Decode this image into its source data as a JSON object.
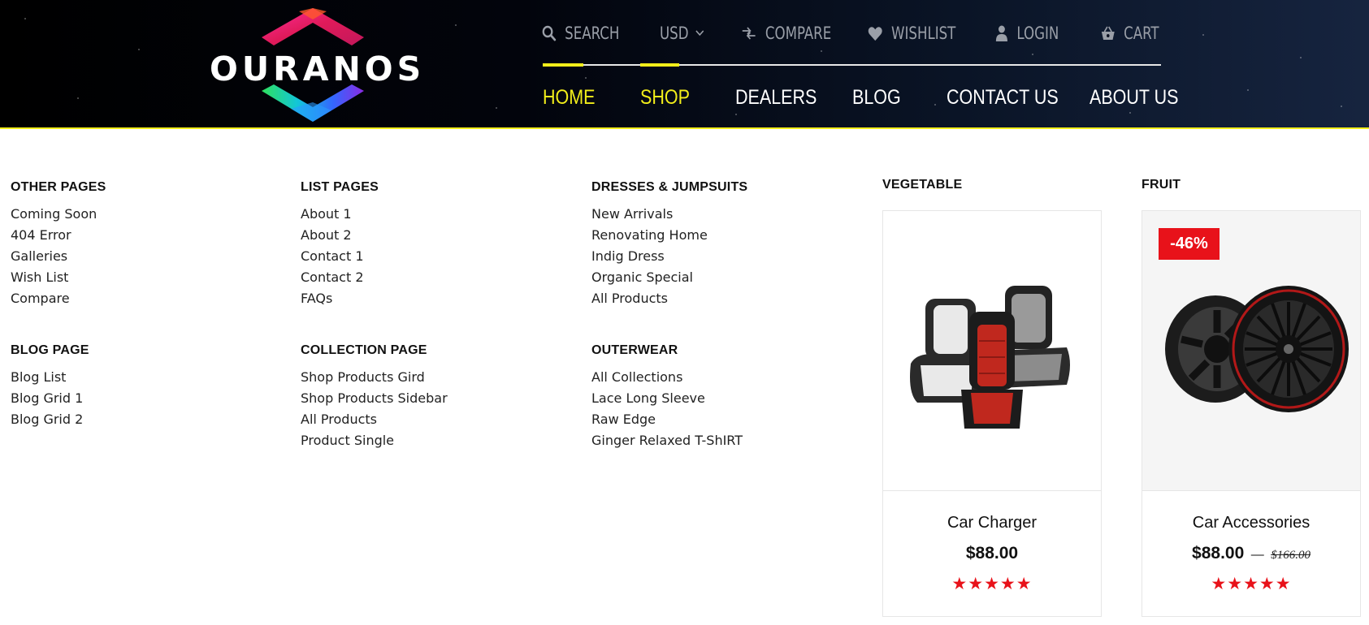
{
  "brand": {
    "name": "OURANOS"
  },
  "topbar": {
    "search": "SEARCH",
    "currency": "USD",
    "compare": "COMPARE",
    "wishlist": "WISHLIST",
    "login": "LOGIN",
    "cart": "CART"
  },
  "nav": {
    "items": [
      {
        "label": "HOME",
        "active": true
      },
      {
        "label": "SHOP",
        "active": true
      },
      {
        "label": "DEALERS",
        "active": false
      },
      {
        "label": "BLOG",
        "active": false
      },
      {
        "label": "CONTACT US",
        "active": false
      },
      {
        "label": "ABOUT US",
        "active": false
      }
    ]
  },
  "colors": {
    "accent": "#f2ee1a",
    "sale": "#e8121a",
    "header_bg": "#000000"
  },
  "menu": {
    "other_pages": {
      "title": "OTHER PAGES",
      "links": [
        "Coming Soon",
        "404 Error",
        "Galleries",
        "Wish List",
        "Compare"
      ]
    },
    "blog_page": {
      "title": "BLOG PAGE",
      "links": [
        "Blog List",
        "Blog Grid 1",
        "Blog Grid 2"
      ]
    },
    "list_pages": {
      "title": "LIST PAGES",
      "links": [
        "About 1",
        "About 2",
        "Contact 1",
        "Contact 2",
        "FAQs"
      ]
    },
    "collection_page": {
      "title": "COLLECTION PAGE",
      "links": [
        "Shop Products Gird",
        "Shop Products Sidebar",
        "All Products",
        "Product Single"
      ]
    },
    "dresses": {
      "title": "DRESSES & JUMPSUITS",
      "links": [
        "New Arrivals",
        "Renovating Home",
        "Indig Dress",
        "Organic Special",
        "All Products"
      ]
    },
    "outerwear": {
      "title": "OUTERWEAR",
      "links": [
        "All Collections",
        "Lace Long Sleeve",
        "Raw Edge",
        "Ginger Relaxed T-ShIRT"
      ]
    }
  },
  "products": {
    "vegetable": {
      "section": "VEGETABLE",
      "name": "Car Charger",
      "price": "$88.00",
      "rating_stars": 5,
      "stars": "★★★★★",
      "image_icon": "car-seats-image"
    },
    "fruit": {
      "section": "FRUIT",
      "badge": "-46%",
      "name": "Car Accessories",
      "price": "$88.00",
      "price_sep": "—",
      "old_price": "$166.00",
      "rating_stars": 5,
      "stars": "★★★★★",
      "image_icon": "car-wheels-image"
    }
  }
}
